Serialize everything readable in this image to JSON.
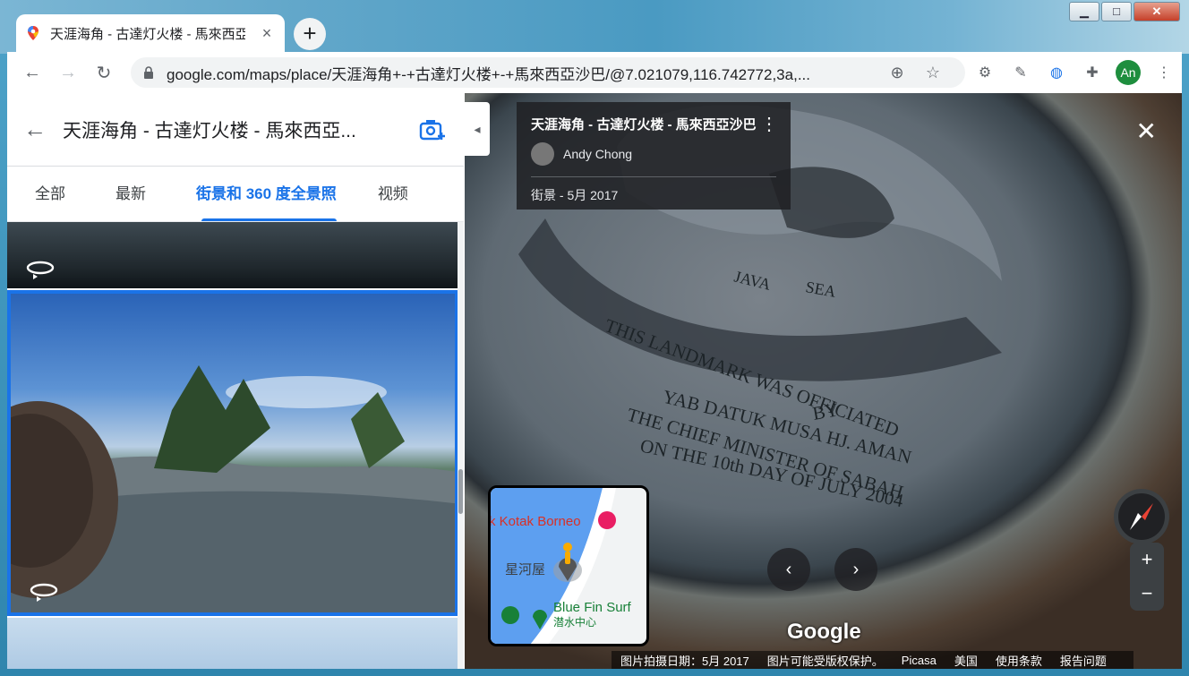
{
  "browser": {
    "tab_title": "天涯海角 - 古達灯火楼 - 馬來西亞沙巴",
    "tab_close": "×",
    "new_tab": "+",
    "url": "google.com/maps/place/天涯海角+-+古達灯火楼+-+馬來西亞沙巴/@7.021079,116.742772,3a,...",
    "profile_initials": "An",
    "window_controls": {
      "minimize": "▁",
      "maximize": "□",
      "close": "✕"
    }
  },
  "sidebar": {
    "back_icon": "arrow-left-icon",
    "place_title": "天涯海角 - 古達灯火楼 - 馬來西亞...",
    "tabs": [
      {
        "label": "全部",
        "active": false
      },
      {
        "label": "最新",
        "active": false
      },
      {
        "label": "街景和 360 度全景照",
        "active": true
      },
      {
        "label": "视频",
        "active": false
      }
    ]
  },
  "streetview": {
    "panel_title": "天涯海角 - 古達灯火楼 - 馬來西亞沙巴",
    "author": "Andy Chong",
    "meta": "街景 - 5月 2017",
    "google_logo": "Google",
    "minimap": {
      "label_hotel": "k Kotak Borneo",
      "label_place": "星河屋",
      "label_poi": "Blue Fin Surf",
      "label_poi_sub": "潜水中心"
    },
    "footer": {
      "date": "图片拍摄日期：5月 2017",
      "copyright": "图片可能受版权保护。",
      "picasa": "Picasa",
      "region": "美国",
      "terms": "使用条款",
      "report": "报告问题"
    },
    "zoom_in": "+",
    "zoom_out": "−"
  }
}
